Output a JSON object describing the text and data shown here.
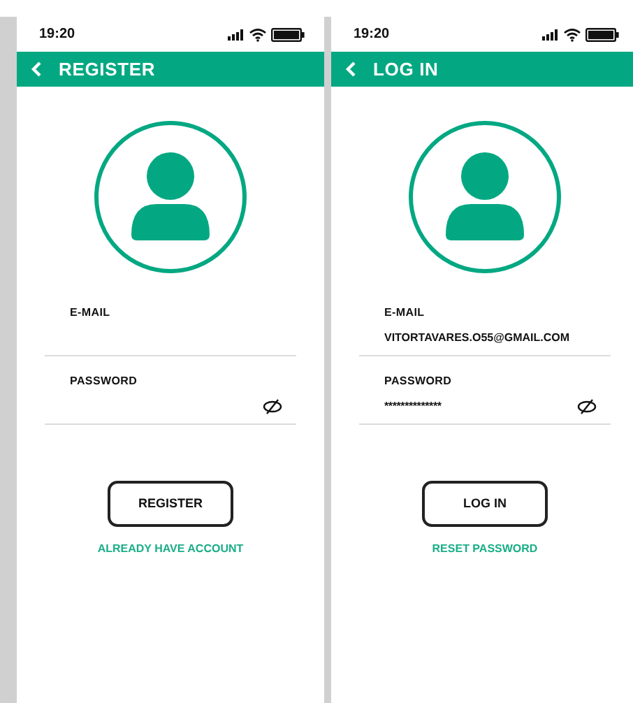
{
  "screens": [
    {
      "time": "19:20",
      "title": "REGISTER",
      "fields": [
        {
          "kind": "text",
          "label": "E-MAIL"
        },
        {
          "kind": "password",
          "label": "PASSWORD"
        }
      ],
      "button": "REGISTER",
      "link": "ALREADY HAVE ACCOUNT"
    },
    {
      "time": "19:20",
      "title": "LOG IN",
      "fields": [
        {
          "kind": "text",
          "label": "E-MAIL",
          "value": "VITORTAVARES.O55@GMAIL.COM"
        },
        {
          "kind": "password",
          "label": "PASSWORD",
          "value": "**************"
        }
      ],
      "button": "LOG IN",
      "link": "RESET PASSWORD"
    }
  ]
}
